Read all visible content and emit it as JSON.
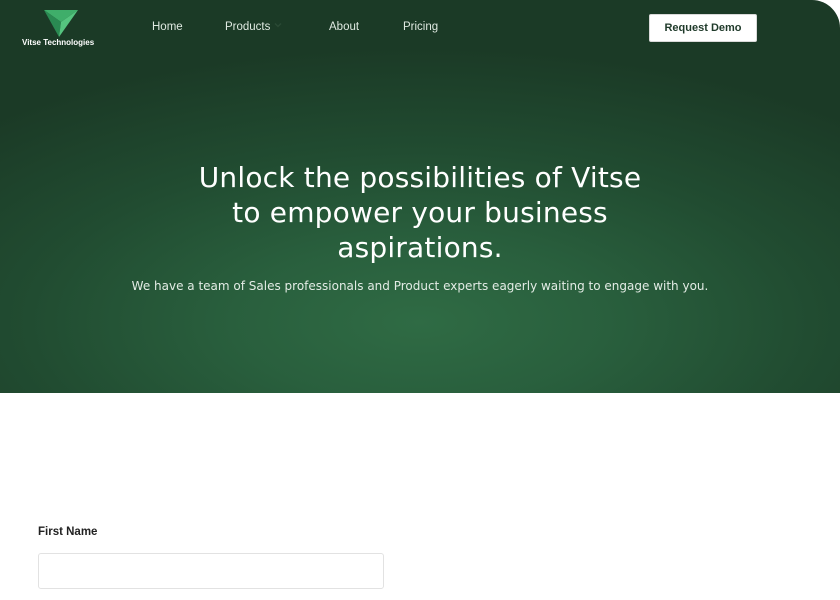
{
  "header": {
    "logo_text": "Vitse Technologies",
    "logo_icon": "vitse-triangle-logo",
    "nav": [
      {
        "label": "Home"
      },
      {
        "label": "Products",
        "icon": "chevron-down-icon"
      },
      {
        "label": "About"
      },
      {
        "label": "Pricing"
      }
    ],
    "cta_label": "Request Demo"
  },
  "hero": {
    "title_lines": [
      "Unlock the possibilities of Vitse",
      "to empower your business",
      "aspirations."
    ],
    "subtitle": "We have a team of Sales professionals and Product experts eagerly waiting to engage with you."
  },
  "form": {
    "first_name_label": "First Name",
    "first_name_value": "",
    "first_name_placeholder": ""
  },
  "colors": {
    "hero_dark": "#1b3a26",
    "hero_light": "#2f6b44",
    "logo_green": "#3fae6a",
    "button_bg": "#ffffff",
    "button_text": "#1f3a2a"
  }
}
